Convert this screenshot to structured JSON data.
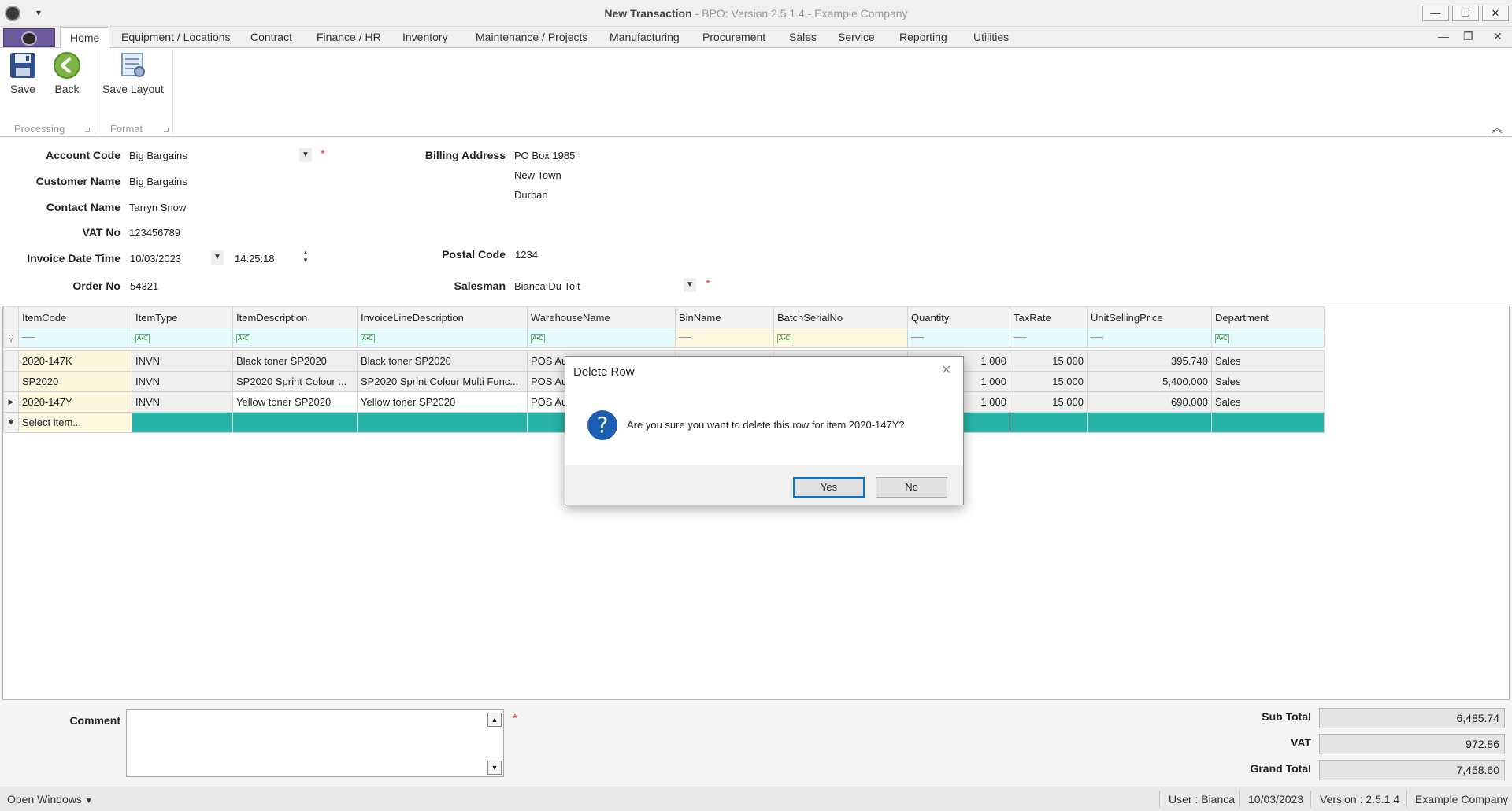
{
  "window": {
    "title_main": "New Transaction",
    "title_sub": "BPO: Version 2.5.1.4 - Example Company",
    "minimize": "—",
    "restore": "❐",
    "close": "✕"
  },
  "ribbon": {
    "tabs": [
      "Home",
      "Equipment / Locations",
      "Contract",
      "Finance / HR",
      "Inventory",
      "Maintenance / Projects",
      "Manufacturing",
      "Procurement",
      "Sales",
      "Service",
      "Reporting",
      "Utilities"
    ],
    "active_tab": "Home",
    "buttons": {
      "save": "Save",
      "back": "Back",
      "save_layout": "Save Layout"
    },
    "groups": {
      "processing": "Processing",
      "format": "Format"
    }
  },
  "form": {
    "account_code": {
      "label": "Account Code",
      "value": "Big Bargains"
    },
    "customer_name": {
      "label": "Customer Name",
      "value": "Big Bargains"
    },
    "contact_name": {
      "label": "Contact Name",
      "value": "Tarryn Snow"
    },
    "vat_no": {
      "label": "VAT No",
      "value": "123456789"
    },
    "invoice_date_time": {
      "label": "Invoice Date Time",
      "date": "10/03/2023",
      "time": "14:25:18"
    },
    "order_no": {
      "label": "Order No",
      "value": "54321"
    },
    "billing_address": {
      "label": "Billing Address",
      "line1": "PO Box 1985",
      "line2": "New Town",
      "line3": "Durban"
    },
    "postal_code": {
      "label": "Postal Code",
      "value": "1234"
    },
    "salesman": {
      "label": "Salesman",
      "value": "Bianca Du Toit"
    },
    "required_mark": "*"
  },
  "grid": {
    "columns": [
      "ItemCode",
      "ItemType",
      "ItemDescription",
      "InvoiceLineDescription",
      "WarehouseName",
      "BinName",
      "BatchSerialNo",
      "Quantity",
      "TaxRate",
      "UnitSellingPrice",
      "Department"
    ],
    "rows": [
      {
        "ItemCode": "2020-147K",
        "ItemType": "INVN",
        "ItemDescription": "Black toner SP2020",
        "InvoiceLineDescription": "Black toner SP2020",
        "WarehouseName": "POS Au",
        "BinName": "",
        "BatchSerialNo": "",
        "Quantity": "1.000",
        "TaxRate": "15.000",
        "UnitSellingPrice": "395.740",
        "Department": "Sales"
      },
      {
        "ItemCode": "SP2020",
        "ItemType": "INVN",
        "ItemDescription": "SP2020 Sprint Colour ...",
        "InvoiceLineDescription": "SP2020 Sprint Colour Multi Func...",
        "WarehouseName": "POS Au",
        "BinName": "",
        "BatchSerialNo": "",
        "Quantity": "1.000",
        "TaxRate": "15.000",
        "UnitSellingPrice": "5,400.000",
        "Department": "Sales"
      },
      {
        "ItemCode": "2020-147Y",
        "ItemType": "INVN",
        "ItemDescription": "Yellow toner SP2020",
        "InvoiceLineDescription": "Yellow toner SP2020",
        "WarehouseName": "POS Au",
        "BinName": "",
        "BatchSerialNo": "",
        "Quantity": "1.000",
        "TaxRate": "15.000",
        "UnitSellingPrice": "690.000",
        "Department": "Sales"
      }
    ],
    "new_row_placeholder": "Select item..."
  },
  "bottom": {
    "comment_label": "Comment",
    "sub_total": {
      "label": "Sub Total",
      "value": "6,485.74"
    },
    "vat": {
      "label": "VAT",
      "value": "972.86"
    },
    "grand_total": {
      "label": "Grand Total",
      "value": "7,458.60"
    }
  },
  "statusbar": {
    "open_windows": "Open Windows",
    "user": "User : Bianca",
    "date": "10/03/2023",
    "version": "Version : 2.5.1.4",
    "company": "Example Company"
  },
  "dialog": {
    "title": "Delete Row",
    "message": "Are you sure you want to delete this row for item 2020-147Y?",
    "yes": "Yes",
    "no": "No"
  }
}
